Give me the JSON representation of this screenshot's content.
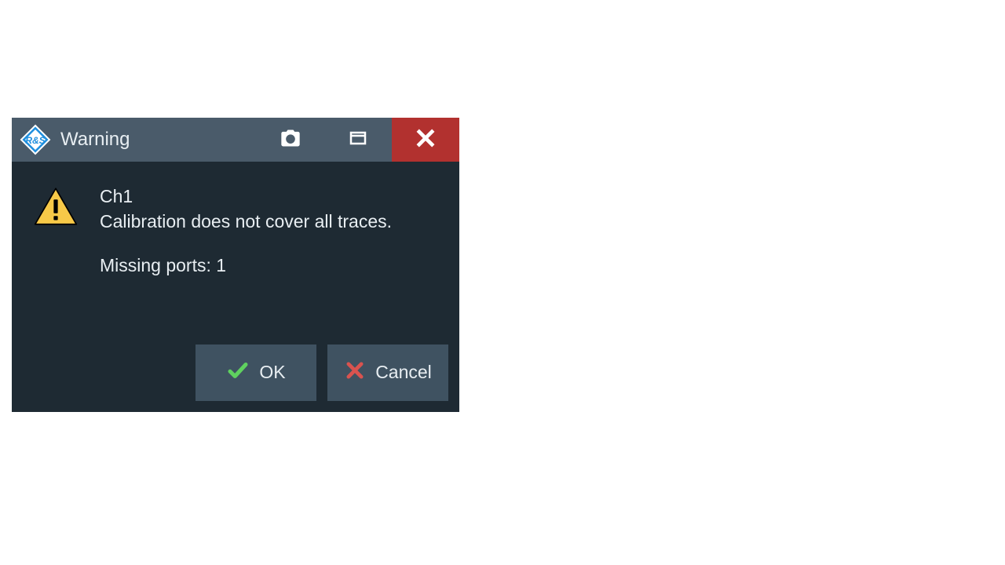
{
  "dialog": {
    "title": "Warning",
    "message": {
      "channel": "Ch1",
      "line1": "Calibration does not cover all traces.",
      "line2": "Missing ports: 1"
    },
    "buttons": {
      "ok": "OK",
      "cancel": "Cancel"
    }
  }
}
